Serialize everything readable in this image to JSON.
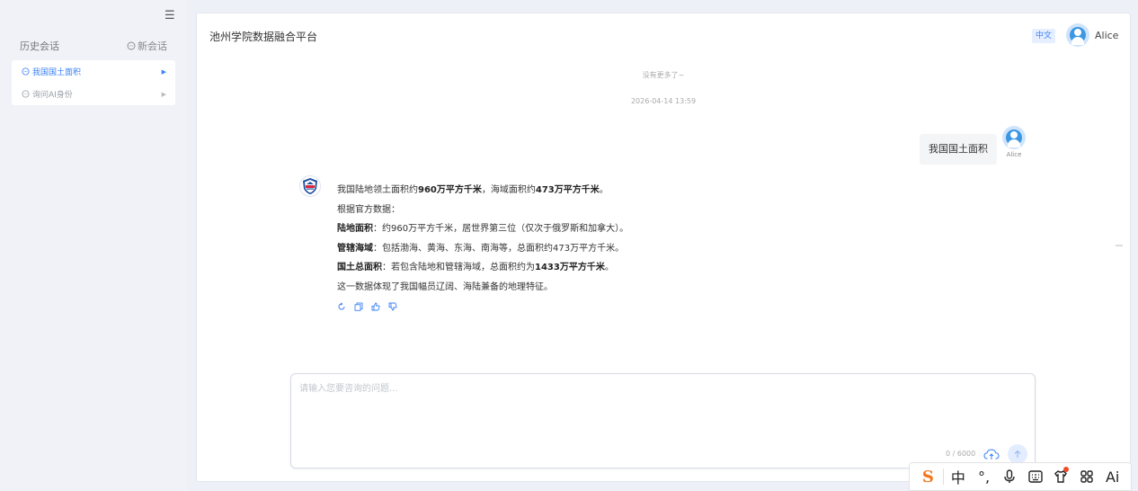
{
  "sidebar": {
    "menu_icon": "☰",
    "history_title": "历史会话",
    "new_chat_label": "新会话",
    "items": [
      {
        "label": "我国国土面积",
        "active": true
      },
      {
        "label": "询问AI身份",
        "active": false
      }
    ]
  },
  "header": {
    "brand": "池州学院数据融合平台",
    "lang": "中文",
    "user": "Alice"
  },
  "chat": {
    "no_more": "没有更多了~",
    "timestamp": "2026-04-14 13:59",
    "user_message": "我国国土面积",
    "user_label": "Alice",
    "ai": {
      "l1_a": "我国陆地领土面积约",
      "l1_b": "960万平方千米",
      "l1_c": "，海域面积约",
      "l1_d": "473万平方千米",
      "l1_e": "。",
      "l2": "根据官方数据：",
      "l3_k": "陆地面积",
      "l3_v": "：约960万平方千米，居世界第三位（仅次于俄罗斯和加拿大）。",
      "l4_k": "管辖海域",
      "l4_v": "：包括渤海、黄海、东海、南海等，总面积约473万平方千米。",
      "l5_k": "国土总面积",
      "l5_v": "：若包含陆地和管辖海域，总面积约为",
      "l5_b": "1433万平方千米",
      "l5_e": "。",
      "l6": "这一数据体现了我国幅员辽阔、海陆兼备的地理特征。"
    }
  },
  "composer": {
    "placeholder": "请输入您要咨询的问题...",
    "counter": "0 / 6000"
  },
  "ime": {
    "logo": "S",
    "zh": "中",
    "punct": "°,",
    "ai": "Ai"
  },
  "colors": {
    "accent": "#3b82f6",
    "ime_logo": "#f5761a"
  }
}
